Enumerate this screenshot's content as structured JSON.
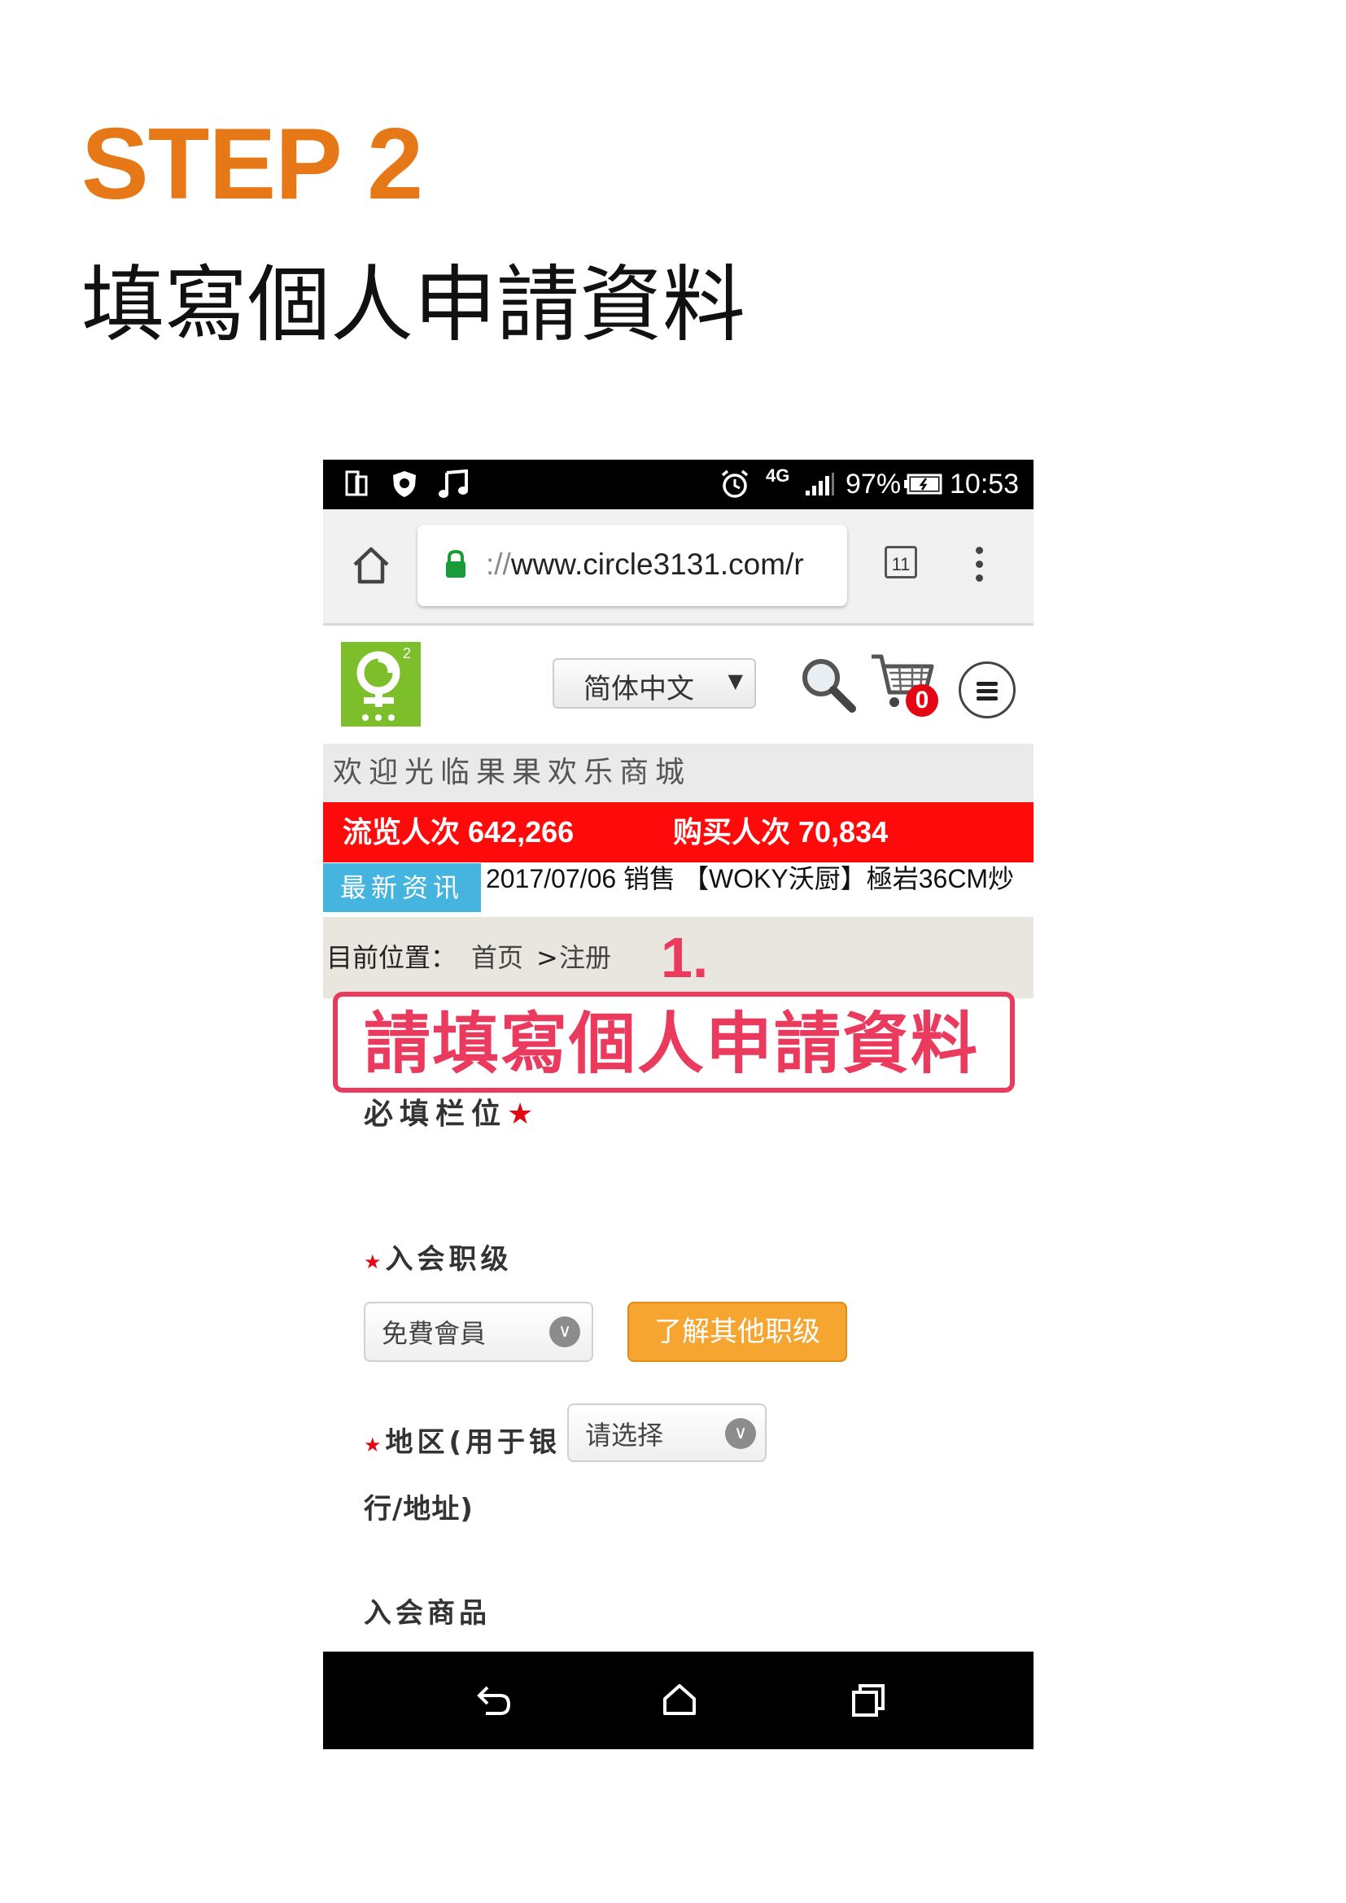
{
  "step": "STEP 2",
  "doc_title": "填寫個人申請資料",
  "status_bar": {
    "battery_percent": "97%",
    "time": "10:53",
    "network": "4G"
  },
  "browser": {
    "url_scheme": "://",
    "url_host": "www.circle3131.com/r",
    "tab_count": "11"
  },
  "site": {
    "language": "简体中文",
    "cart_count": "0",
    "welcome": "欢迎光临果果欢乐商城",
    "views_label": "流览人次 642,266",
    "buyers_label": "购买人次 70,834",
    "news_tag": "最新资讯",
    "news_text": "2017/07/06 销售 【WOKY沃厨】極岩36CM炒"
  },
  "breadcrumb": {
    "prefix": "目前位置：",
    "home": "首页",
    "separator": ">",
    "current": "注册"
  },
  "annotation": {
    "number": "1.",
    "text": "請填寫個人申請資料"
  },
  "form": {
    "required_note": "必填栏位",
    "required_star": "★",
    "level_label": "入会职级",
    "level_value": "免費會員",
    "learn_more": "了解其他职级",
    "region_label_line1": "地区(用于银",
    "region_label_line2": "行/地址)",
    "region_value": "请选择",
    "product_label": "入会商品"
  },
  "colors": {
    "step_orange": "#e67817",
    "annotation_red": "#ea3a5d",
    "counter_red": "#ff0a0a",
    "news_blue": "#45b4df",
    "button_orange": "#f7a531",
    "logo_green": "#7cbf2b"
  }
}
